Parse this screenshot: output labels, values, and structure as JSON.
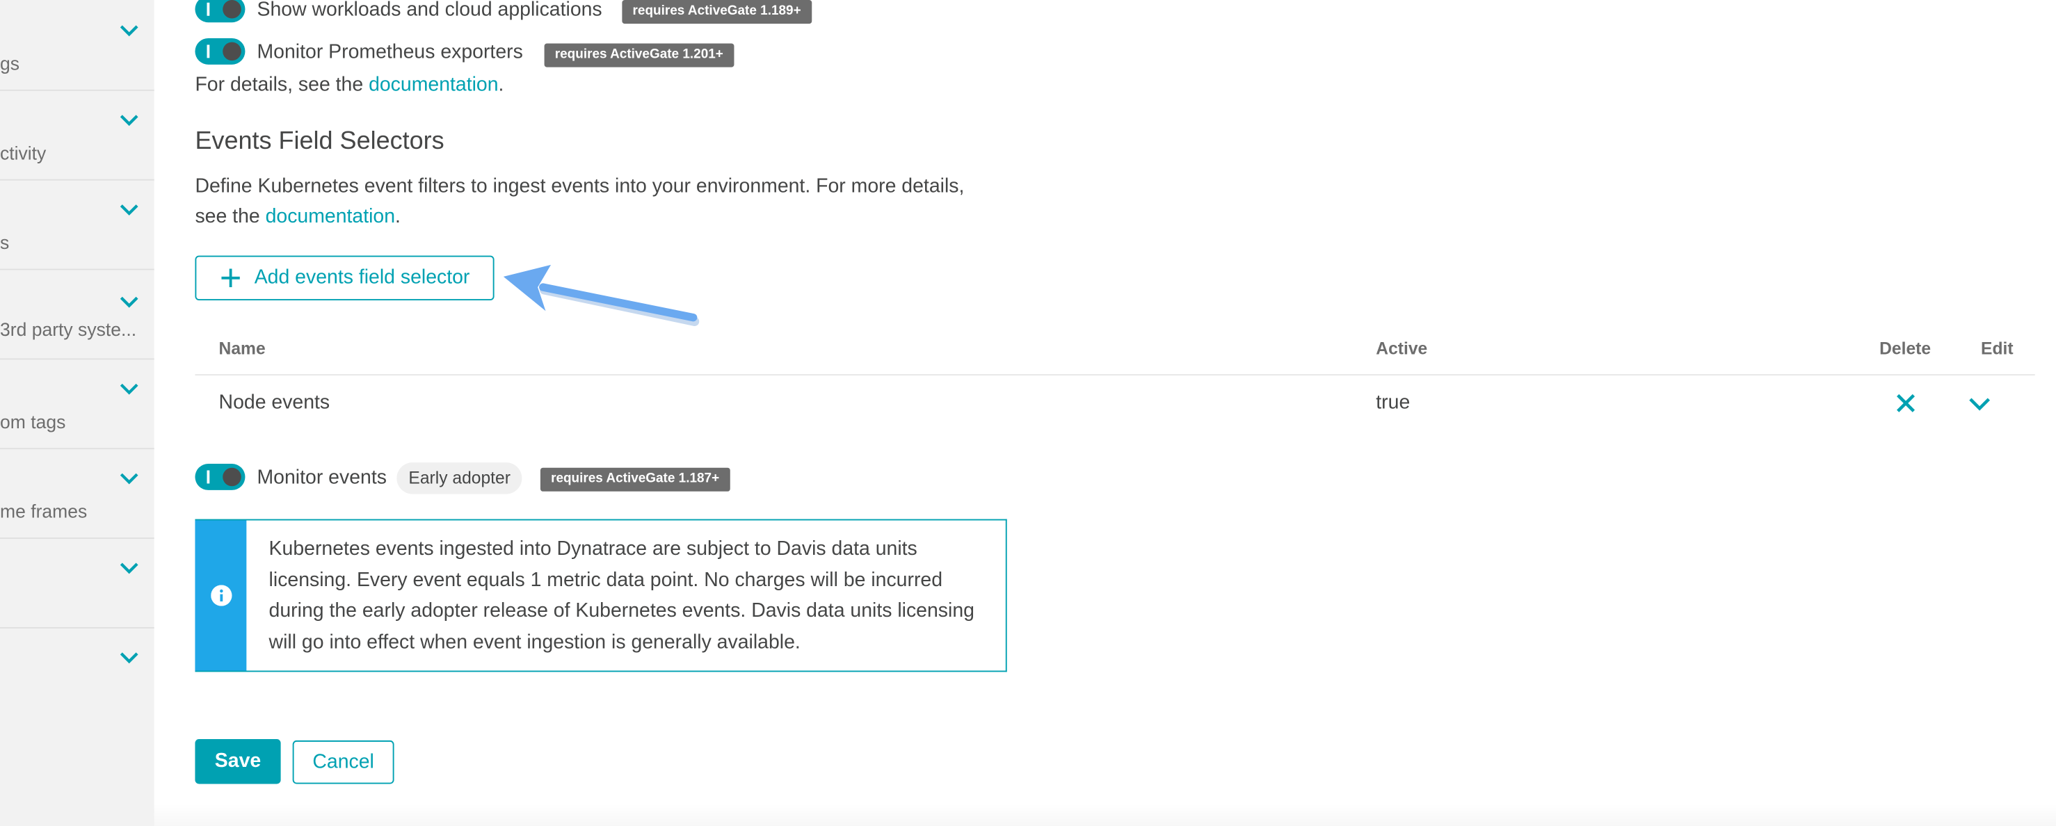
{
  "sidebar": {
    "items": [
      {
        "label": "gs"
      },
      {
        "label": "ctivity"
      },
      {
        "label": "s"
      },
      {
        "label": "3rd party syste..."
      },
      {
        "label": "om tags"
      },
      {
        "label": "me frames"
      },
      {
        "label": ""
      },
      {
        "label": ""
      }
    ],
    "chevron_icon": "chevron-down-icon"
  },
  "options": {
    "workloads": {
      "label": "Show workloads and cloud applications",
      "badge": "requires ActiveGate 1.189+",
      "enabled": true
    },
    "prometheus": {
      "label": "Monitor Prometheus exporters",
      "badge": "requires ActiveGate 1.201+",
      "enabled": true
    },
    "details_prefix": "For details, see the ",
    "details_link": "documentation",
    "details_suffix": "."
  },
  "events_selectors": {
    "title": "Events Field Selectors",
    "description_line1": "Define Kubernetes event filters to ingest events into your environment. For more details,",
    "description_prefix": "see the ",
    "description_link": "documentation",
    "description_suffix": ".",
    "add_button": "Add events field selector",
    "table": {
      "headers": {
        "name": "Name",
        "active": "Active",
        "delete": "Delete",
        "edit": "Edit"
      },
      "rows": [
        {
          "name": "Node events",
          "active": "true"
        }
      ]
    }
  },
  "monitor_events": {
    "label": "Monitor events",
    "tag": "Early adopter",
    "badge": "requires ActiveGate 1.187+",
    "enabled": true,
    "info_text": "Kubernetes events ingested into Dynatrace are subject to Davis data units licensing. Every event equals 1 metric data point. No charges will be incurred during the early adopter release of Kubernetes events. Davis data units licensing will go into effect when event ingestion is generally available."
  },
  "actions": {
    "save": "Save",
    "cancel": "Cancel"
  },
  "colors": {
    "accent": "#00a1b2",
    "info": "#1fa7e8",
    "badge": "#6d6d6d",
    "annotation_arrow": "#6aa9f0"
  }
}
